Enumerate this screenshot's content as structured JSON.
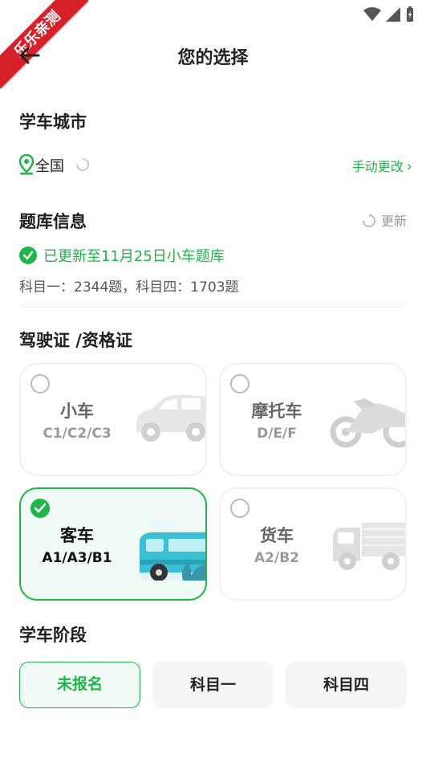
{
  "watermark": "乐乐亲测",
  "header": {
    "title": "您的选择"
  },
  "city": {
    "section_title": "学车城市",
    "value": "全国",
    "change_label": "手动更改"
  },
  "question_bank": {
    "section_title": "题库信息",
    "update_label": "更新",
    "updated_text": "已更新至11月25日小车题库",
    "counts_text": "科目一：2344题，科目四：1703题"
  },
  "license": {
    "section_title": "驾驶证 /资格证",
    "cards": [
      {
        "name": "小车",
        "codes": "C1/C2/C3",
        "selected": false,
        "icon": "car-icon"
      },
      {
        "name": "摩托车",
        "codes": "D/E/F",
        "selected": false,
        "icon": "motorcycle-icon"
      },
      {
        "name": "客车",
        "codes": "A1/A3/B1",
        "selected": true,
        "icon": "bus-icon"
      },
      {
        "name": "货车",
        "codes": "A2/B2",
        "selected": false,
        "icon": "truck-icon"
      }
    ]
  },
  "stage": {
    "section_title": "学车阶段",
    "options": [
      {
        "label": "未报名",
        "active": true
      },
      {
        "label": "科目一",
        "active": false
      },
      {
        "label": "科目四",
        "active": false
      }
    ]
  },
  "colors": {
    "accent": "#1fb548",
    "ribbon": "#d6202a"
  }
}
